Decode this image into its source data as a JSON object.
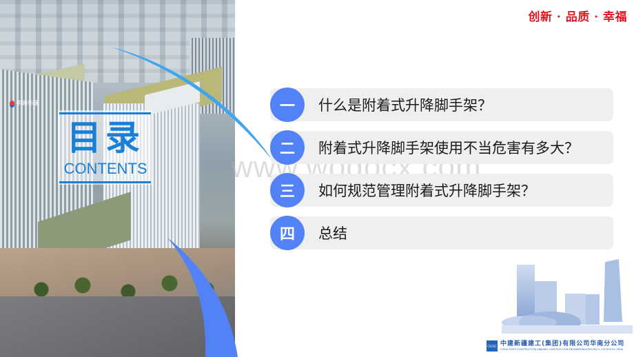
{
  "slide": {
    "tagline": "创新 · 品质 · 幸福",
    "title_cn": "目录",
    "title_en": "CONTENTS",
    "photo_sign_text": "中建新疆",
    "watermark": "www.wodocx.com"
  },
  "toc": {
    "items": [
      {
        "number": "一",
        "label": "什么是附着式升降脚手架？"
      },
      {
        "number": "二",
        "label": "附着式升降脚手架使用不当危害有多大？"
      },
      {
        "number": "三",
        "label": "如何规范管理附着式升降脚手架？"
      },
      {
        "number": "四",
        "label": "总结"
      }
    ]
  },
  "company": {
    "logo_mark": "CSCEC",
    "name_cn": "中建新疆建工(集团)有限公司华南分公司",
    "name_en": "CHINA STATE CONSTRUCTION XINJIANG CONSTRUCTION ENGINEERING(GROUP)CO.,LTD.SOUTH CHINA"
  },
  "colors": {
    "accent_blue": "#5282f5",
    "title_blue": "#1a7fd6",
    "arc_light_blue": "#3fa6ee",
    "tagline_red": "#e2161e",
    "item_bg": "#efefef"
  }
}
